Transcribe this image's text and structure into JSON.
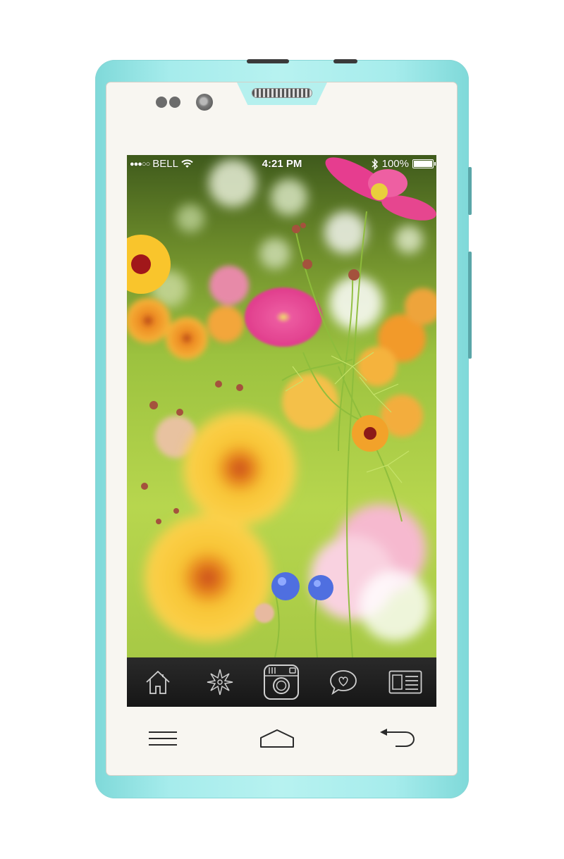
{
  "status_bar": {
    "signal": "●●●○○",
    "carrier": "BELL",
    "time": "4:21  PM",
    "battery_percent": "100%",
    "battery_level": 1.0,
    "icons": [
      "signal-dots-icon",
      "wifi-icon",
      "bluetooth-icon",
      "battery-icon"
    ]
  },
  "dock": {
    "items": [
      {
        "icon": "home-icon"
      },
      {
        "icon": "compass-star-icon"
      },
      {
        "icon": "instagram-camera-icon"
      },
      {
        "icon": "heart-chat-bubble-icon"
      },
      {
        "icon": "layout-panels-icon"
      }
    ]
  },
  "nav_bar": {
    "items": [
      {
        "icon": "menu-icon"
      },
      {
        "icon": "home-outline-icon"
      },
      {
        "icon": "back-arrow-icon"
      }
    ]
  },
  "colors": {
    "phone_body": "#a6ecec",
    "front_panel": "#f8f6f1",
    "dock_background": "#1c1c1c",
    "dock_icon": "#cfcfcf"
  }
}
